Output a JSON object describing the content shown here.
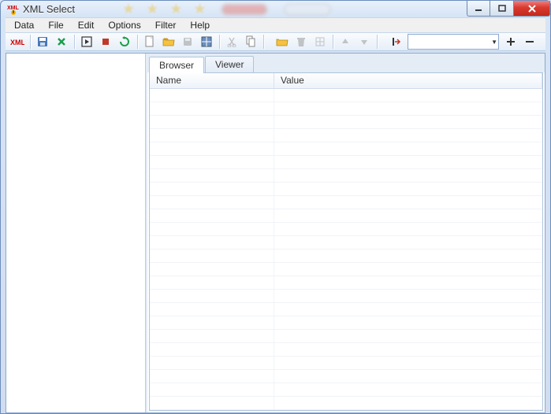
{
  "window": {
    "title": "XML Select"
  },
  "menu": {
    "data": "Data",
    "file": "File",
    "edit": "Edit",
    "options": "Options",
    "filter": "Filter",
    "help": "Help"
  },
  "toolbar": {
    "combo_value": ""
  },
  "tabs": {
    "browser": "Browser",
    "viewer": "Viewer",
    "active": "browser"
  },
  "grid": {
    "columns": {
      "name": "Name",
      "value": "Value"
    },
    "rows": []
  }
}
